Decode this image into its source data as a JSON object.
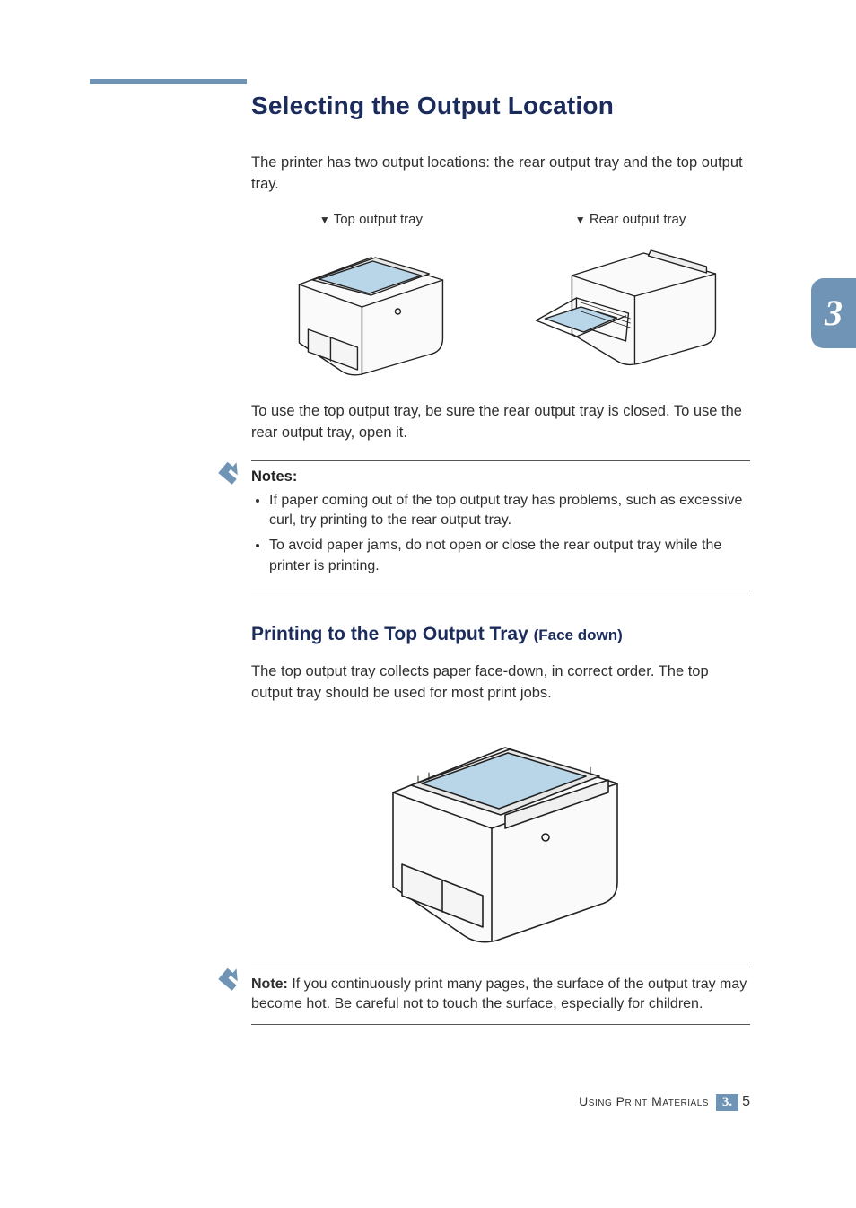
{
  "rule": {
    "present": true
  },
  "heading": "Selecting the Output Location",
  "intro": "The printer has two output locations: the rear output tray and the top output tray.",
  "figures": {
    "left_label": "Top output tray",
    "right_label": "Rear output tray"
  },
  "body_after_figs": "To use the top output tray, be sure the rear output tray is closed. To use the rear output tray, open it.",
  "notes": {
    "title": "Notes:",
    "items": [
      "If paper coming out of the top output tray has problems, such as excessive curl, try printing to the rear output tray.",
      "To avoid paper jams, do not open or close the rear output tray while the printer is printing."
    ]
  },
  "subheading": {
    "main": "Printing to the Top Output Tray ",
    "sub": "(Face down)"
  },
  "sub_intro": "The top output tray collects paper face-down, in correct order. The top output tray should be used for most print jobs.",
  "single_note": {
    "label": "Note: ",
    "text": "If you continuously print many pages, the surface of the output tray may become hot. Be careful not to touch the surface, especially for children."
  },
  "tab": {
    "chapter": "3"
  },
  "footer": {
    "chapter_name": "Using Print Materials",
    "chapter_prefix": "3.",
    "page_number": "5"
  },
  "icons": {
    "down_triangle": "▼"
  }
}
